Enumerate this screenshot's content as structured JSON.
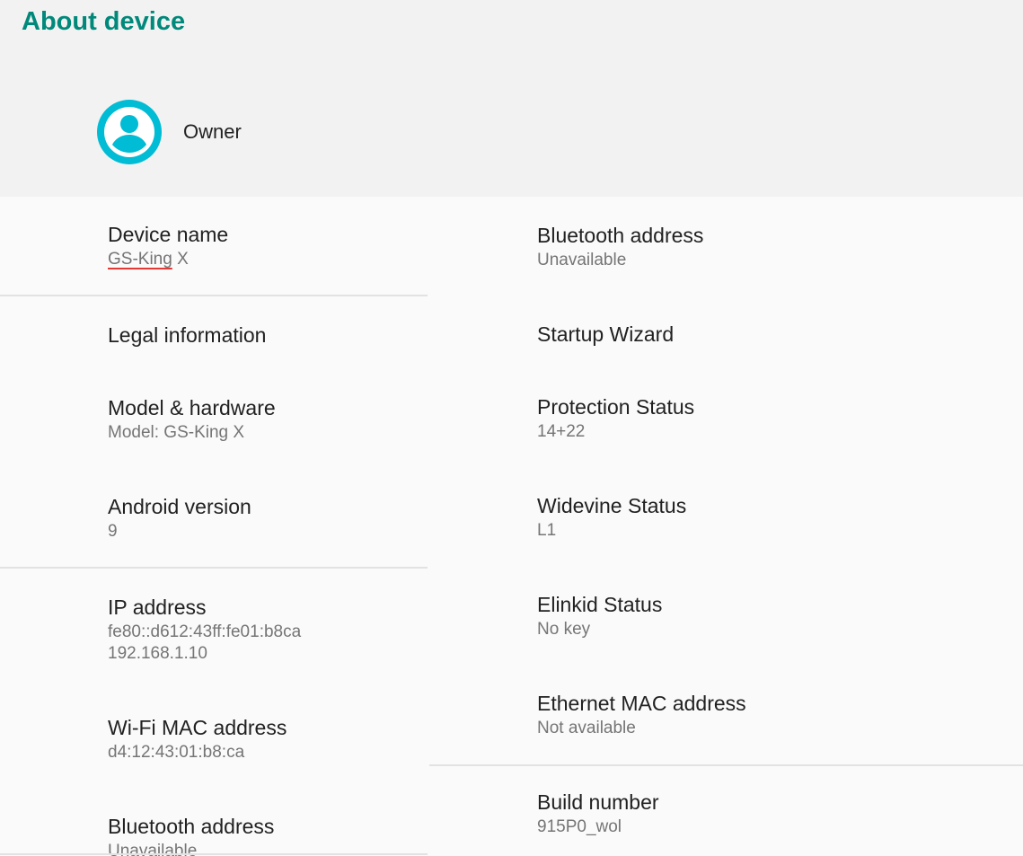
{
  "colors": {
    "accent": "#00897b",
    "avatar": "#00bcd4"
  },
  "header": {
    "title": "About device",
    "owner_name": "Owner",
    "owner_icon": "account-circle-icon"
  },
  "left_column": {
    "device_name": {
      "title": "Device name",
      "summary_underlined": "GS-King",
      "summary_rest": " X"
    },
    "legal": {
      "title": "Legal information"
    },
    "model": {
      "title": "Model & hardware",
      "summary": "Model: GS-King X"
    },
    "android": {
      "title": "Android version",
      "summary": "9"
    },
    "ip": {
      "title": "IP address",
      "summary_line1": "fe80::d612:43ff:fe01:b8ca",
      "summary_line2": "192.168.1.10"
    },
    "wifi_mac": {
      "title": "Wi-Fi MAC address",
      "summary": "d4:12:43:01:b8:ca"
    },
    "bluetooth": {
      "title": "Bluetooth address",
      "summary": "Unavailable"
    }
  },
  "right_column": {
    "bluetooth": {
      "title": "Bluetooth address",
      "summary": "Unavailable"
    },
    "startup": {
      "title": "Startup Wizard"
    },
    "protection": {
      "title": "Protection Status",
      "summary": "14+22"
    },
    "widevine": {
      "title": "Widevine Status",
      "summary": "L1"
    },
    "elinkid": {
      "title": "Elinkid Status",
      "summary": "No key"
    },
    "ethernet_mac": {
      "title": "Ethernet MAC address",
      "summary": "Not available"
    },
    "build": {
      "title": "Build number",
      "summary": "915P0_wol"
    }
  }
}
